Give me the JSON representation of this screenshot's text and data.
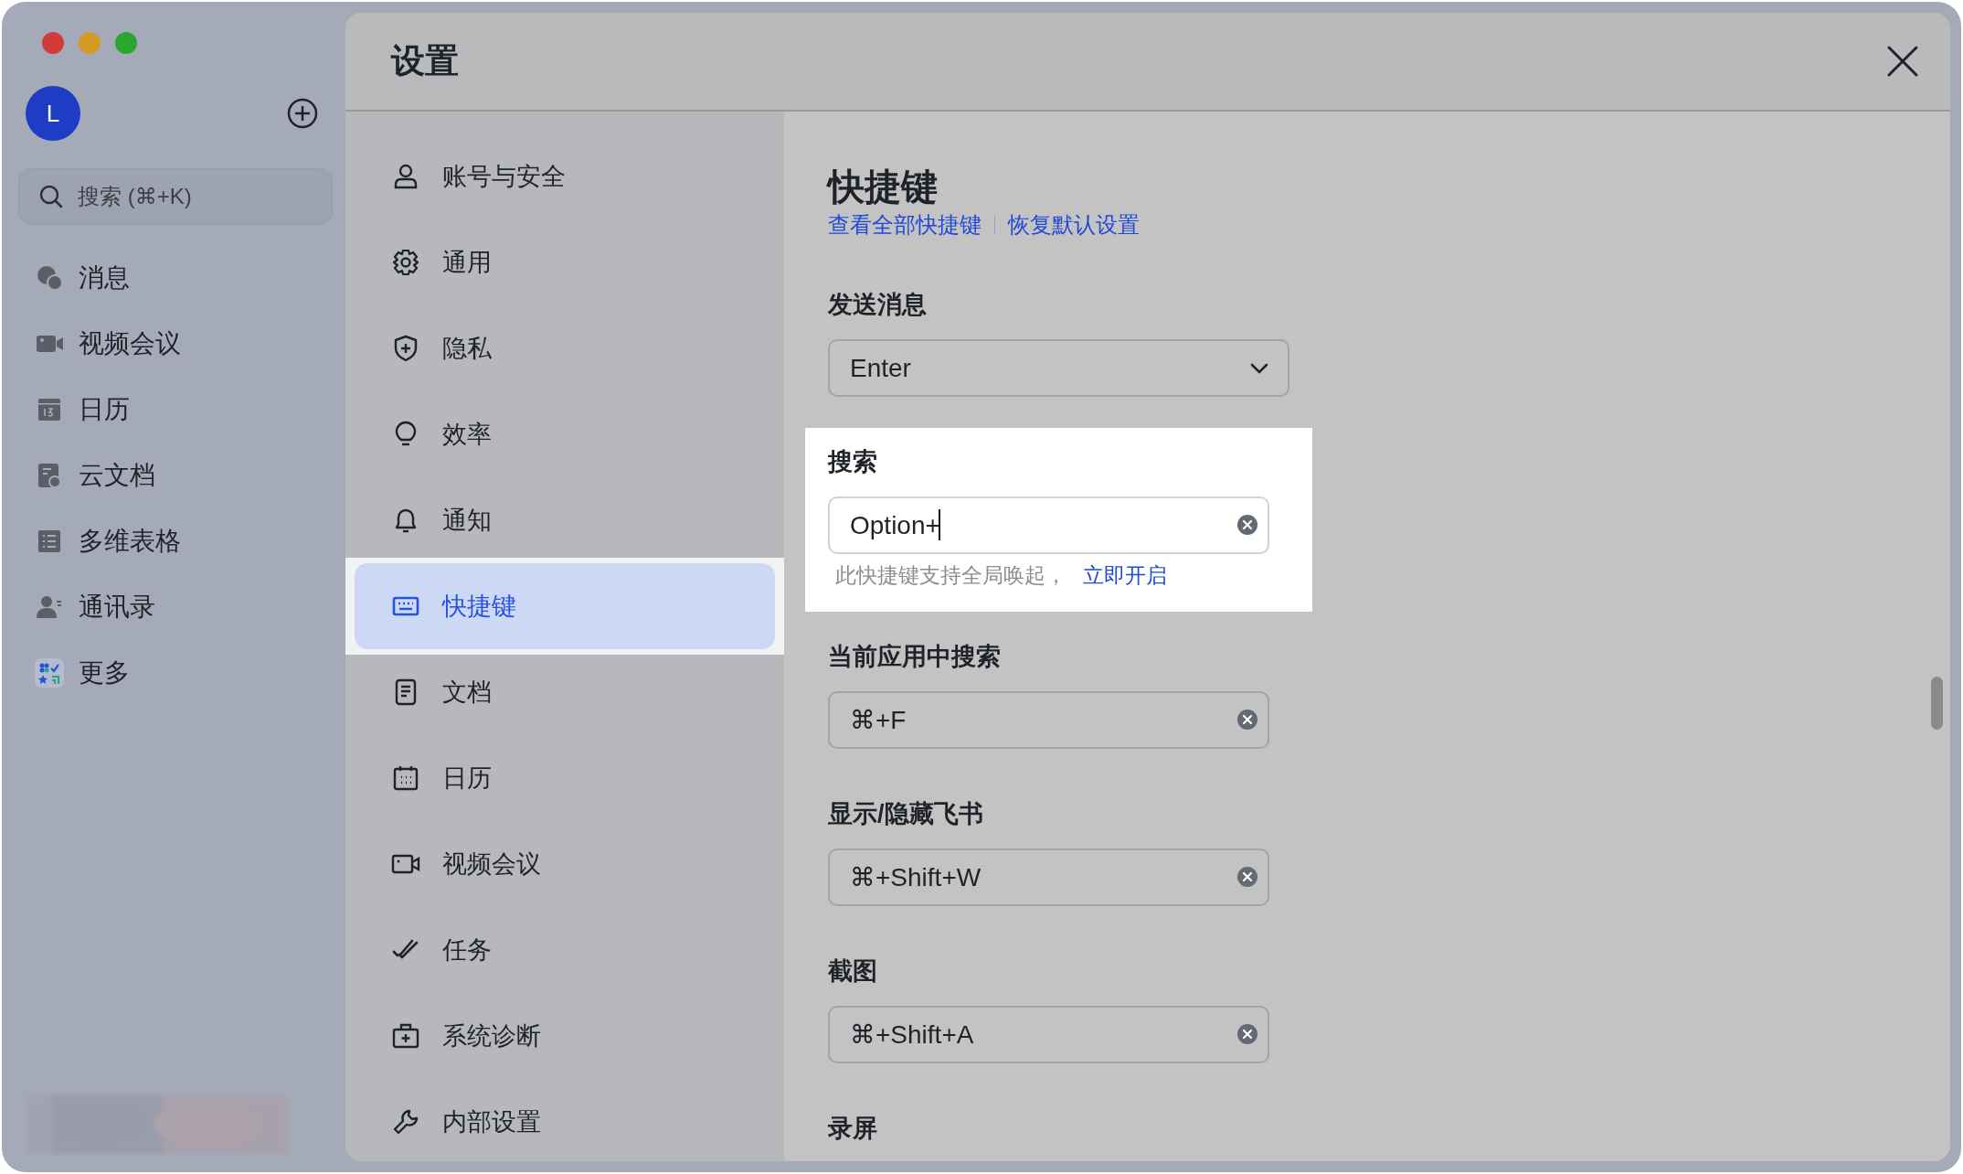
{
  "sidebar": {
    "avatar_letter": "L",
    "search": {
      "placeholder": "搜索 (⌘+K)"
    },
    "items": [
      {
        "label": "消息"
      },
      {
        "label": "视频会议"
      },
      {
        "label": "日历"
      },
      {
        "label": "云文档"
      },
      {
        "label": "多维表格"
      },
      {
        "label": "通讯录"
      },
      {
        "label": "更多"
      }
    ]
  },
  "settings": {
    "title": "设置",
    "nav": [
      {
        "label": "账号与安全",
        "selected": false
      },
      {
        "label": "通用",
        "selected": false
      },
      {
        "label": "隐私",
        "selected": false
      },
      {
        "label": "效率",
        "selected": false
      },
      {
        "label": "通知",
        "selected": false
      },
      {
        "label": "快捷键",
        "selected": true
      },
      {
        "label": "文档",
        "selected": false
      },
      {
        "label": "日历",
        "selected": false
      },
      {
        "label": "视频会议",
        "selected": false
      },
      {
        "label": "任务",
        "selected": false
      },
      {
        "label": "系统诊断",
        "selected": false
      },
      {
        "label": "内部设置",
        "selected": false
      }
    ],
    "content": {
      "title": "快捷键",
      "links": [
        "查看全部快捷键",
        "恢复默认设置"
      ],
      "sections": [
        {
          "label": "发送消息",
          "kind": "select",
          "value": "Enter",
          "focused": false
        },
        {
          "label": "搜索",
          "kind": "input",
          "value": "Option+",
          "focused": true,
          "hint": "此快捷键支持全局唤起，",
          "hint_link": "立即开启"
        },
        {
          "label": "当前应用中搜索",
          "kind": "input",
          "value": "⌘+F",
          "focused": false
        },
        {
          "label": "显示/隐藏飞书",
          "kind": "input",
          "value": "⌘+Shift+W",
          "focused": false
        },
        {
          "label": "截图",
          "kind": "input",
          "value": "⌘+Shift+A",
          "focused": false
        },
        {
          "label": "录屏",
          "kind": "heading",
          "focused": false
        }
      ]
    }
  }
}
